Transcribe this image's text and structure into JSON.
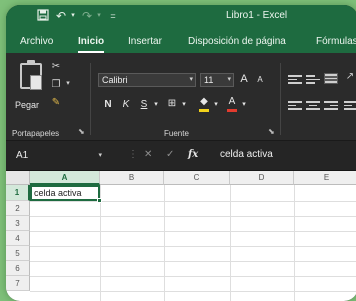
{
  "window": {
    "title": "Libro1 - Excel"
  },
  "quick_access": {
    "save_icon": "save-icon",
    "undo_icon": "undo-icon",
    "redo_icon": "redo-icon",
    "customize_icon": "customize-toolbar-icon"
  },
  "ribbon_tabs": [
    {
      "label": "Archivo",
      "active": false
    },
    {
      "label": "Inicio",
      "active": true
    },
    {
      "label": "Insertar",
      "active": false
    },
    {
      "label": "Disposición de página",
      "active": false
    },
    {
      "label": "Fórmulas",
      "active": false
    }
  ],
  "clipboard": {
    "paste_label": "Pegar",
    "group_label": "Portapapeles"
  },
  "font": {
    "group_label": "Fuente",
    "font_name": "Calibri",
    "font_size": "11",
    "grow_font": "A",
    "shrink_font": "A",
    "bold": "N",
    "italic": "K",
    "underline": "S"
  },
  "formula_bar": {
    "name_box": "A1",
    "cancel_icon": "cancel-icon",
    "enter_icon": "enter-icon",
    "fx_label": "fx",
    "content": "celda activa"
  },
  "grid": {
    "columns": [
      "A",
      "B",
      "C",
      "D",
      "E"
    ],
    "rows": [
      "1",
      "2",
      "3",
      "4",
      "5",
      "6",
      "7"
    ],
    "active_column": "A",
    "active_row": "1",
    "cells": {
      "A1": "celda activa"
    }
  },
  "colors": {
    "excel_green": "#1e6b40",
    "ribbon_dark": "#2b2b2b",
    "font_color_underline": "#e23b2e",
    "fill_color_underline": "#f2d21b"
  }
}
